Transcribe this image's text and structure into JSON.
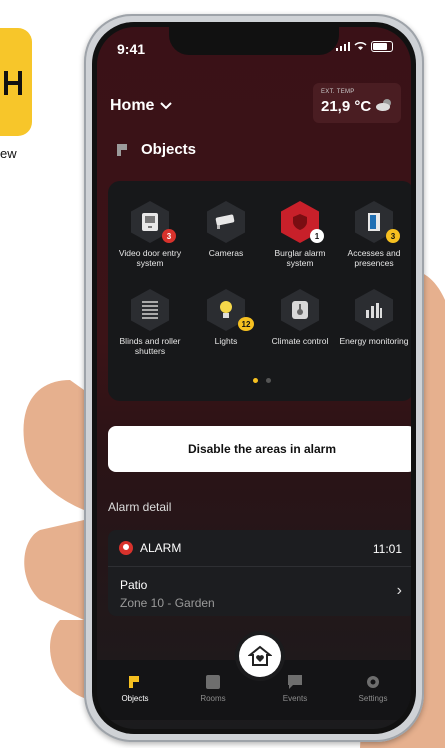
{
  "promo": {
    "text": "ew"
  },
  "status": {
    "time": "9:41"
  },
  "header": {
    "title": "Home",
    "weather_label": "EXT. TEMP",
    "weather_value": "21,9 °C"
  },
  "objects": {
    "title": "Objects",
    "tiles": [
      {
        "label": "Video door entry system",
        "badge": "3",
        "icon": "video-door-icon"
      },
      {
        "label": "Cameras",
        "badge": "",
        "icon": "camera-icon"
      },
      {
        "label": "Burglar alarm system",
        "badge": "1",
        "icon": "shield-icon"
      },
      {
        "label": "Accesses and presences",
        "badge": "3",
        "icon": "door-icon"
      },
      {
        "label": "Blinds and roller shutters",
        "badge": "",
        "icon": "blinds-icon"
      },
      {
        "label": "Lights",
        "badge": "12",
        "icon": "bulb-icon"
      },
      {
        "label": "Climate control",
        "badge": "",
        "icon": "thermometer-icon"
      },
      {
        "label": "Energy monitoring",
        "badge": "",
        "icon": "energy-icon"
      }
    ]
  },
  "actions": {
    "disable_label": "Disable the areas in alarm"
  },
  "alarm_detail": {
    "title": "Alarm detail",
    "status": "ALARM",
    "time": "11:01",
    "location": "Patio",
    "zone": "Zone 10 - Garden"
  },
  "tabs": [
    {
      "label": "Objects"
    },
    {
      "label": "Rooms"
    },
    {
      "label": "Events"
    },
    {
      "label": "Settings"
    }
  ],
  "colors": {
    "accent": "#f6c020",
    "alarm": "#c8202a",
    "background": "#3a1117"
  }
}
